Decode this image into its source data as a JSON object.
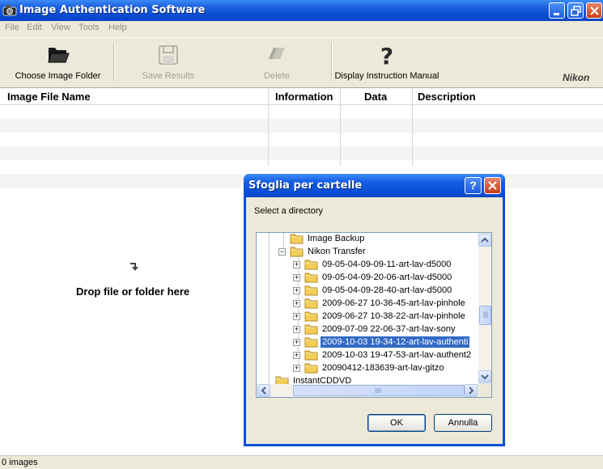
{
  "window": {
    "title": "Image Authentication Software"
  },
  "menu": [
    "File",
    "Edit",
    "View",
    "Tools",
    "Help"
  ],
  "toolbar": {
    "choose_folder": "Choose Image Folder",
    "save_results": "Save Results",
    "delete": "Delete",
    "display_manual": "Display Instruction Manual",
    "brand": "Nikon"
  },
  "table": {
    "columns": [
      "Image File Name",
      "Information",
      "Data",
      "Description"
    ],
    "drop_hint": "Drop file or folder here"
  },
  "status": {
    "text": "0 images"
  },
  "dialog": {
    "title": "Sfoglia per cartelle",
    "prompt": "Select a directory",
    "tree": [
      {
        "label": "Image Backup",
        "expander": ""
      },
      {
        "label": "Nikon Transfer",
        "expander": "-"
      },
      {
        "label": "09-05-04-09-09-11-art-lav-d5000",
        "expander": "+"
      },
      {
        "label": "09-05-04-09-20-06-art-lav-d5000",
        "expander": "+"
      },
      {
        "label": "09-05-04-09-28-40-art-lav-d5000",
        "expander": "+"
      },
      {
        "label": "2009-06-27 10-36-45-art-lav-pinhole",
        "expander": "+"
      },
      {
        "label": "2009-06-27 10-38-22-art-lav-pinhole",
        "expander": "+"
      },
      {
        "label": "2009-07-09 22-06-37-art-lav-sony",
        "expander": "+"
      },
      {
        "label": "2009-10-03 19-34-12-art-lav-authenti",
        "expander": "+",
        "selected": true
      },
      {
        "label": "2009-10-03 19-47-53-art-lav-authent2",
        "expander": "+"
      },
      {
        "label": "20090412-183639-art-lav-gitzo",
        "expander": "+"
      },
      {
        "label": "InstantCDDVD",
        "expander": ""
      }
    ],
    "ok": "OK",
    "cancel": "Annulla"
  },
  "colors": {
    "title_blue": "#0A4DD3",
    "selection": "#316AC5",
    "close_red": "#C43F19"
  }
}
